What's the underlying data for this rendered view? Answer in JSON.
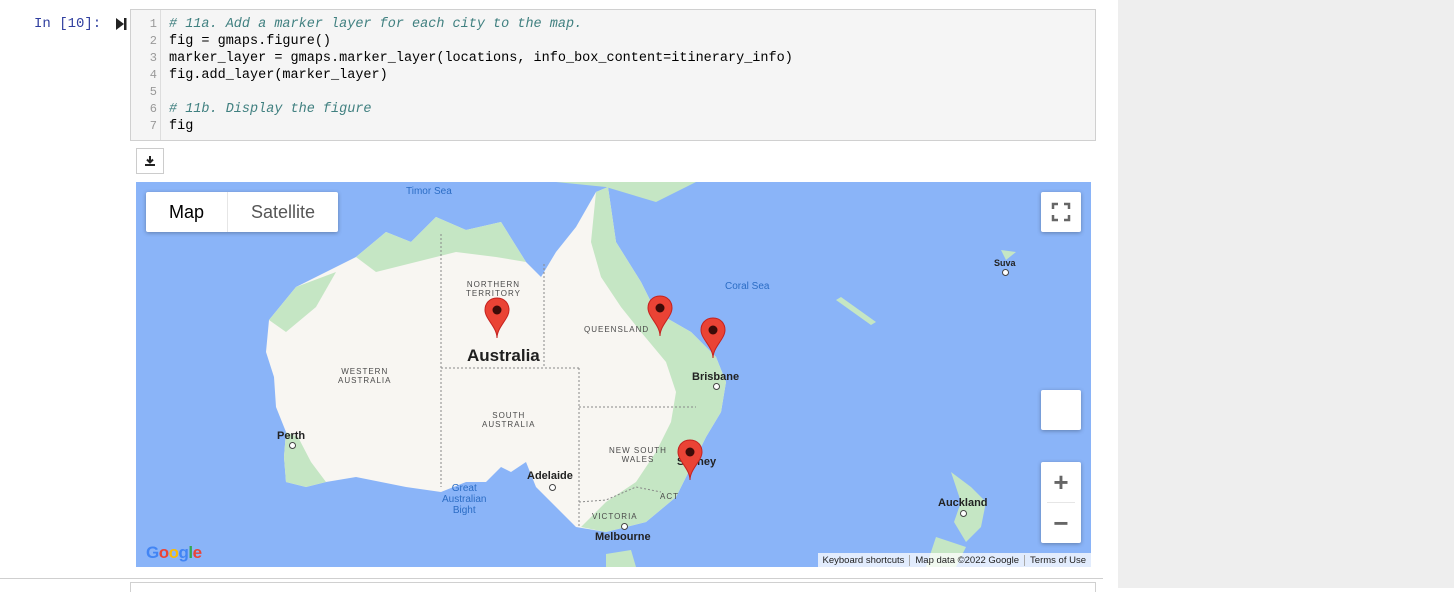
{
  "cell": {
    "prompt": "In [10]:",
    "lines": [
      {
        "n": "1",
        "text": "# 11a. Add a marker layer for each city to the map.",
        "kind": "comment"
      },
      {
        "n": "2",
        "text": "fig = gmaps.figure()",
        "kind": "code"
      },
      {
        "n": "3",
        "text": "marker_layer = gmaps.marker_layer(locations, info_box_content=itinerary_info)",
        "kind": "code"
      },
      {
        "n": "4",
        "text": "fig.add_layer(marker_layer)",
        "kind": "code"
      },
      {
        "n": "5",
        "text": "",
        "kind": "code"
      },
      {
        "n": "6",
        "text": "# 11b. Display the figure",
        "kind": "comment"
      },
      {
        "n": "7",
        "text": "fig",
        "kind": "code"
      }
    ]
  },
  "toolbar": {
    "download_icon": "download-icon"
  },
  "map": {
    "type_controls": {
      "map": "Map",
      "satellite": "Satellite"
    },
    "zoom_in": "+",
    "zoom_out": "−",
    "labels": {
      "timor_sea": "Timor Sea",
      "coral_sea": "Coral Sea",
      "northern_territory": "NORTHERN\nTERRITORY",
      "queensland": "QUEENSLAND",
      "western_australia": "WESTERN\nAUSTRALIA",
      "south_australia": "SOUTH\nAUSTRALIA",
      "new_south_wales": "NEW SOUTH\nWALES",
      "victoria": "VICTORIA",
      "act": "ACT",
      "australia": "Australia",
      "great_bight": "Great\nAustralian\nBight",
      "perth": "Perth",
      "adelaide": "Adelaide",
      "melbourne": "Melbourne",
      "brisbane": "Brisbane",
      "sydney": "Sydney",
      "suva": "Suva",
      "auckland": "Auckland"
    },
    "attribution": {
      "shortcuts": "Keyboard shortcuts",
      "map_data": "Map data ©2022 Google",
      "terms": "Terms of Use"
    },
    "logo": {
      "text": "Google",
      "colors": [
        "#4285f4",
        "#ea4335",
        "#fbbc05",
        "#4285f4",
        "#34a853",
        "#ea4335"
      ]
    },
    "marker_color": "#ea4335",
    "land_color": "#f8f6f2",
    "vegetation_color": "#c5e6c4",
    "water_color": "#8ab4f8"
  }
}
